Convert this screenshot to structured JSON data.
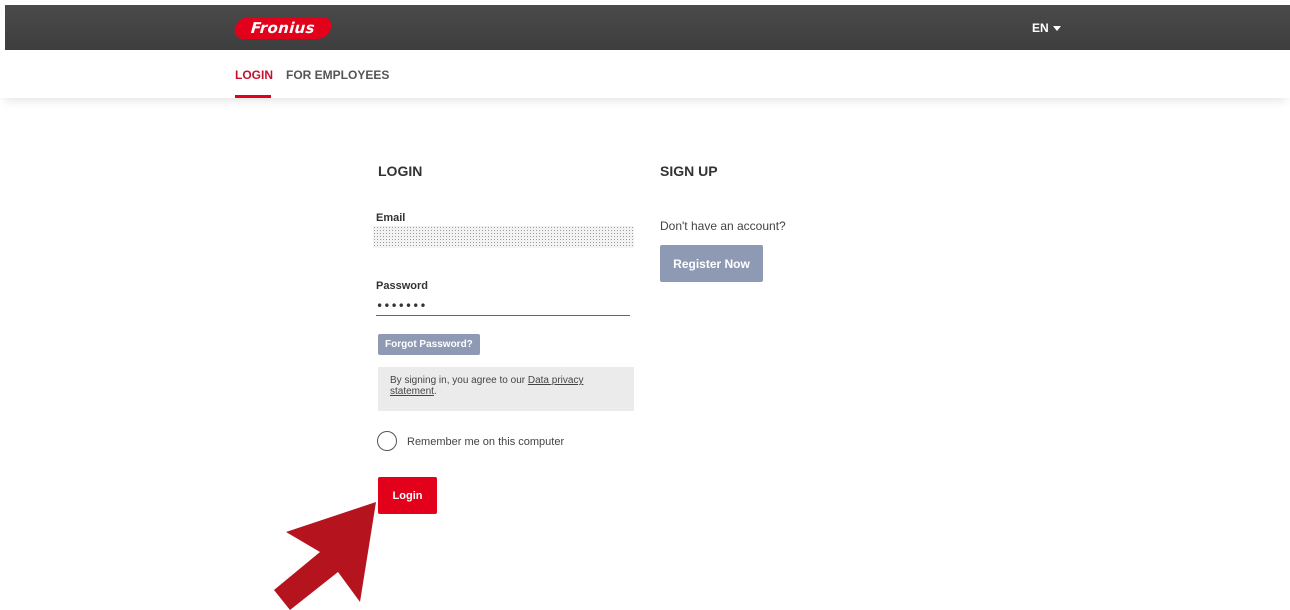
{
  "header": {
    "logo_text": "Fronius",
    "language": "EN",
    "language_icon": "caret-down-icon"
  },
  "tabs": [
    {
      "label": "LOGIN",
      "active": true
    },
    {
      "label": "FOR EMPLOYEES",
      "active": false
    }
  ],
  "login": {
    "heading": "LOGIN",
    "email_label": "Email",
    "email_value": "",
    "password_label": "Password",
    "password_value": "•••••••",
    "forgot_label": "Forgot Password?",
    "notice_prefix": "By signing in, you agree to our ",
    "notice_link": "Data privacy statement",
    "notice_suffix": ".",
    "remember_label": "Remember me on this computer",
    "submit_label": "Login"
  },
  "signup": {
    "heading": "SIGN UP",
    "prompt": "Don't have an account?",
    "button_label": "Register Now"
  },
  "colors": {
    "brand_red": "#e2001a",
    "header_bg": "#444444",
    "secondary_button": "#8e9ab3",
    "annotation_arrow": "#b5141f"
  }
}
